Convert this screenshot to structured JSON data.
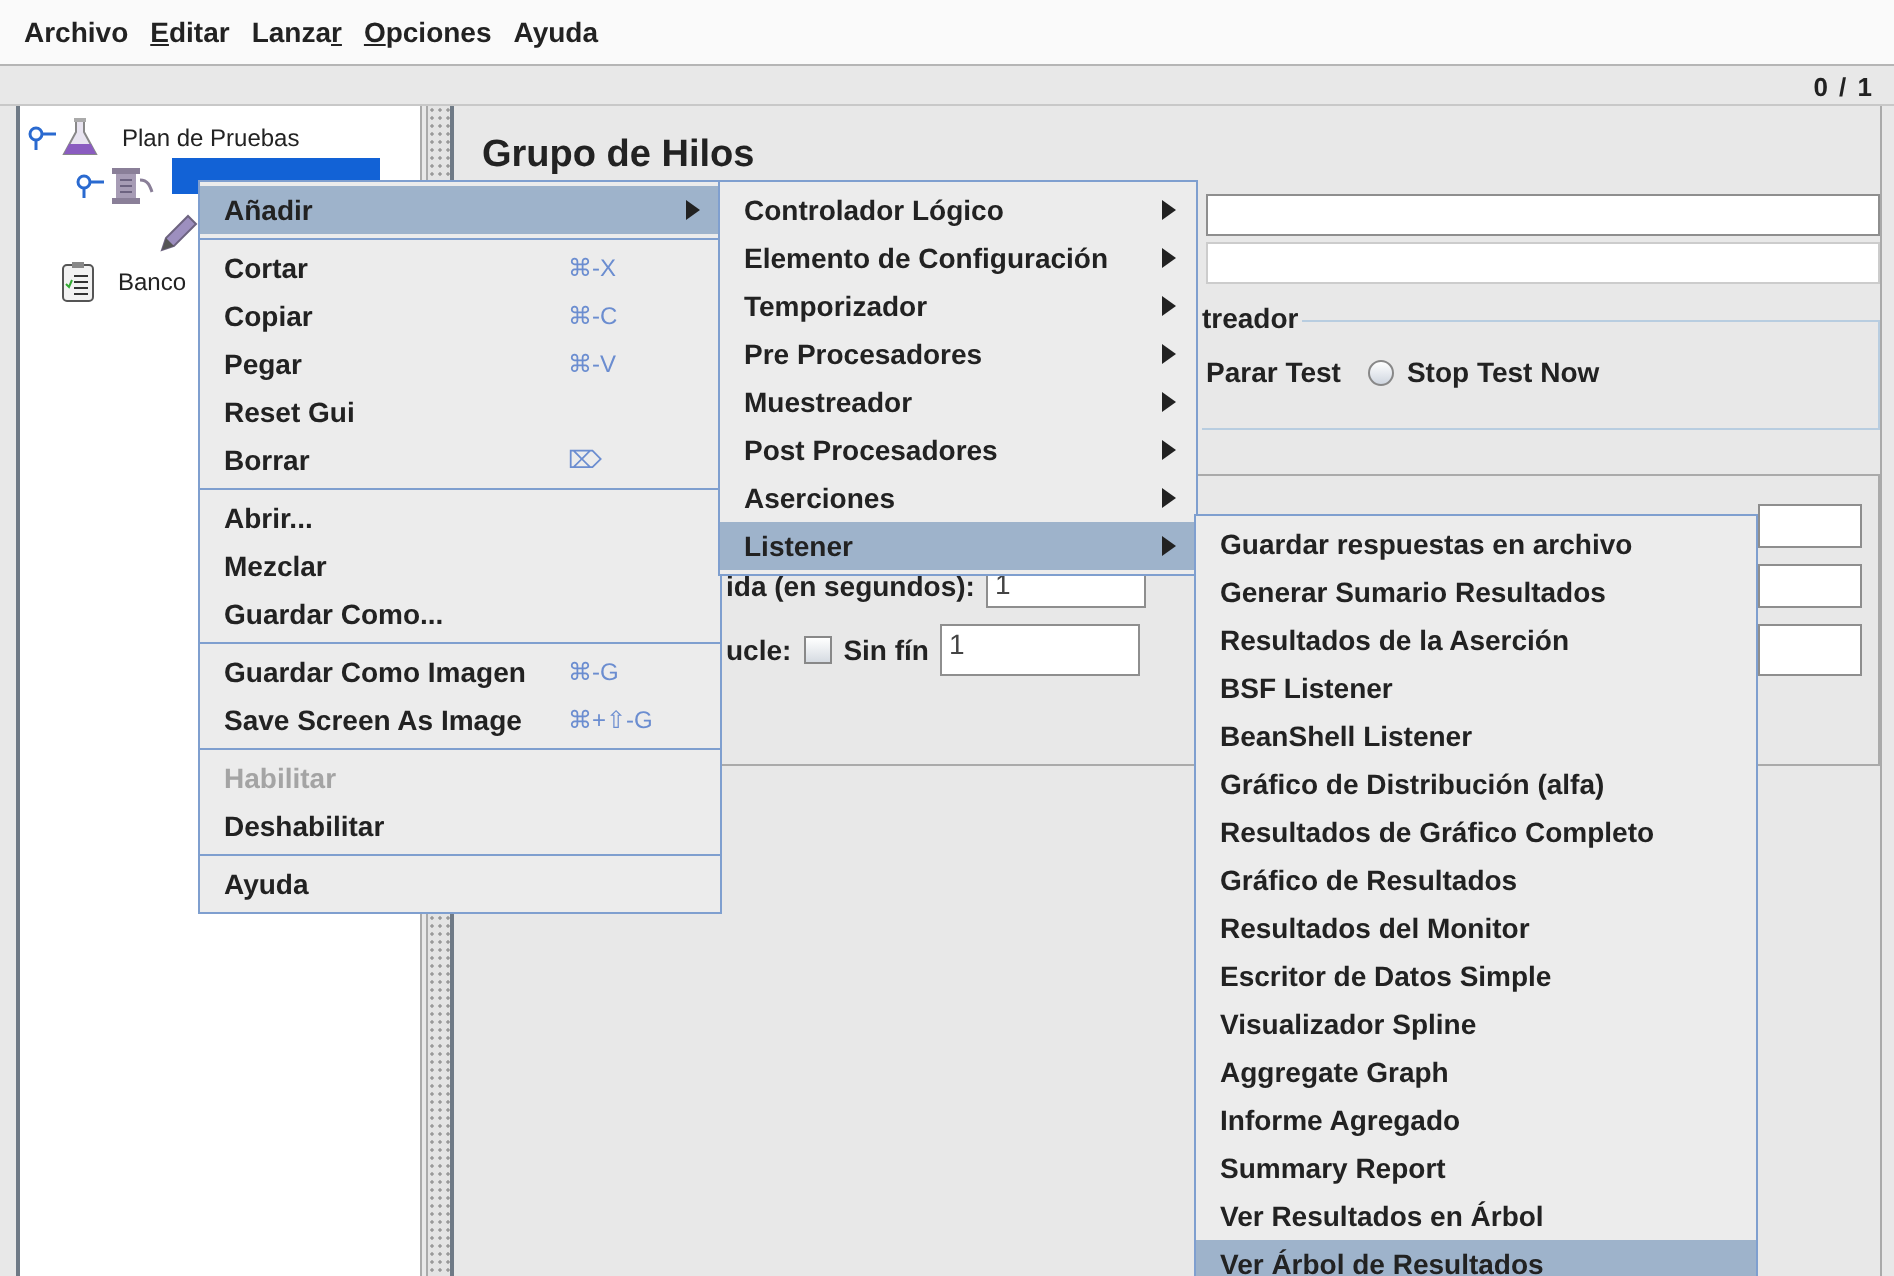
{
  "menubar": [
    {
      "label": "Archivo"
    },
    {
      "mnemonic": "E",
      "text_after": "ditar"
    },
    {
      "text_before": "Lanza",
      "mnemonic": "r"
    },
    {
      "mnemonic": "O",
      "text_after": "pciones"
    },
    {
      "label": "Ayuda"
    }
  ],
  "toolbar": {
    "counter": "0 / 1"
  },
  "tree": [
    {
      "label": "Plan de Pruebas",
      "kind": "test-plan",
      "selected": false,
      "expanded": true,
      "children": [
        {
          "kind": "thread-group",
          "selected": true,
          "expanded": true,
          "children": [
            {
              "kind": "sampler",
              "selected": false,
              "expanded": false
            }
          ]
        }
      ]
    },
    {
      "label": "Banco",
      "kind": "workbench",
      "selected": false,
      "expanded": false
    }
  ],
  "panel": {
    "title": "Grupo de Hilos",
    "error_fieldset": {
      "legend": "treador",
      "options": [
        {
          "label": "Parar Test",
          "kind": "text"
        },
        {
          "label": "Stop Test Now",
          "kind": "radio",
          "selected": false
        }
      ]
    },
    "duration_label": "ida (en segundos):",
    "duration_value": "1",
    "loop_label": "ucle:",
    "forever": {
      "label": "Sin fín",
      "checked": false
    },
    "loop_value": "1"
  },
  "context_menu": {
    "groups": [
      [
        {
          "label": "Añadir",
          "has_submenu": true,
          "selected": true,
          "disabled": false
        }
      ],
      [
        {
          "label": "Cortar",
          "shortcut": "⌘-X",
          "selected": false,
          "disabled": false
        },
        {
          "label": "Copiar",
          "shortcut": "⌘-C",
          "selected": false,
          "disabled": false
        },
        {
          "label": "Pegar",
          "shortcut": "⌘-V",
          "selected": false,
          "disabled": false
        },
        {
          "label": "Reset Gui",
          "selected": false,
          "disabled": false
        },
        {
          "label": "Borrar",
          "shortcut": "⌦",
          "selected": false,
          "disabled": false
        }
      ],
      [
        {
          "label": "Abrir...",
          "selected": false,
          "disabled": false
        },
        {
          "label": "Mezclar",
          "selected": false,
          "disabled": false
        },
        {
          "label": "Guardar Como...",
          "selected": false,
          "disabled": false
        }
      ],
      [
        {
          "label": "Guardar Como Imagen",
          "shortcut": "⌘-G",
          "selected": false,
          "disabled": false
        },
        {
          "label": "Save Screen As Image",
          "shortcut": "⌘+⇧-G",
          "selected": false,
          "disabled": false
        }
      ],
      [
        {
          "label": "Habilitar",
          "selected": false,
          "disabled": true
        },
        {
          "label": "Deshabilitar",
          "selected": false,
          "disabled": false
        }
      ],
      [
        {
          "label": "Ayuda",
          "selected": false,
          "disabled": false
        }
      ]
    ]
  },
  "add_submenu": [
    {
      "label": "Controlador Lógico",
      "has_submenu": true,
      "selected": false
    },
    {
      "label": "Elemento de Configuración",
      "has_submenu": true,
      "selected": false
    },
    {
      "label": "Temporizador",
      "has_submenu": true,
      "selected": false
    },
    {
      "label": "Pre Procesadores",
      "has_submenu": true,
      "selected": false
    },
    {
      "label": "Muestreador",
      "has_submenu": true,
      "selected": false
    },
    {
      "label": "Post Procesadores",
      "has_submenu": true,
      "selected": false
    },
    {
      "label": "Aserciones",
      "has_submenu": true,
      "selected": false
    },
    {
      "label": "Listener",
      "has_submenu": true,
      "selected": true
    }
  ],
  "listener_submenu": [
    {
      "label": "Guardar respuestas en archivo",
      "selected": false
    },
    {
      "label": "Generar Sumario Resultados",
      "selected": false
    },
    {
      "label": "Resultados de la Aserción",
      "selected": false
    },
    {
      "label": "BSF Listener",
      "selected": false
    },
    {
      "label": "BeanShell Listener",
      "selected": false
    },
    {
      "label": "Gráfico de Distribución (alfa)",
      "selected": false
    },
    {
      "label": "Resultados de Gráfico Completo",
      "selected": false
    },
    {
      "label": "Gráfico de Resultados",
      "selected": false
    },
    {
      "label": "Resultados del Monitor",
      "selected": false
    },
    {
      "label": "Escritor de Datos Simple",
      "selected": false
    },
    {
      "label": "Visualizador Spline",
      "selected": false
    },
    {
      "label": "Aggregate Graph",
      "selected": false
    },
    {
      "label": "Informe Agregado",
      "selected": false
    },
    {
      "label": "Summary Report",
      "selected": false
    },
    {
      "label": "Ver Resultados en Árbol",
      "selected": false
    },
    {
      "label": "Ver Árbol de Resultados",
      "selected": true
    }
  ]
}
